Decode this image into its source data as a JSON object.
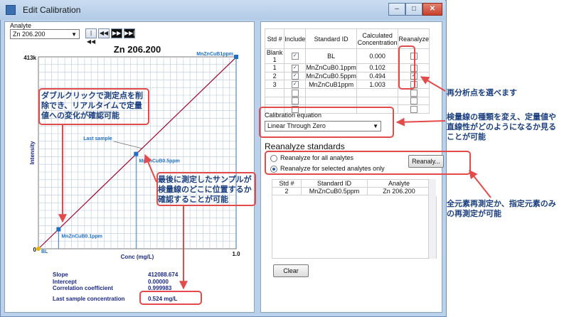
{
  "window": {
    "title": "Edit Calibration"
  },
  "analyte": {
    "label": "Analyte",
    "selected": "Zn 206.200"
  },
  "nav": [
    "|◀◀",
    "◀◀",
    "▶▶",
    "▶▶|"
  ],
  "chart_data": {
    "type": "scatter",
    "title": "Zn 206.200",
    "xlabel": "Conc (mg/L)",
    "ylabel": "Intensity",
    "xlim": [
      0,
      1.0
    ],
    "ylim": [
      0,
      413000
    ],
    "y_tick_labels": [
      "0",
      "413k"
    ],
    "x_tick_labels": [
      "0",
      "1.0"
    ],
    "grid": true,
    "points": [
      {
        "label": "BL",
        "x": 0.0,
        "y": 0
      },
      {
        "label": "MnZnCuB0.1ppm",
        "x": 0.102,
        "y": 42000
      },
      {
        "label": "MnZnCuB0.5ppm",
        "x": 0.494,
        "y": 204000
      },
      {
        "label": "MnZnCuB1ppm",
        "x": 1.003,
        "y": 413000
      }
    ],
    "last_sample": {
      "label": "Last sample",
      "x": 0.524,
      "y": 216000
    },
    "fit_line": {
      "x": [
        0,
        1.0
      ],
      "y": [
        0,
        412089
      ]
    }
  },
  "stats": {
    "slope_label": "Slope",
    "slope": "412088.674",
    "intercept_label": "Intercept",
    "intercept": "0.00000",
    "corr_label": "Correlation coefficient",
    "corr": "0.999983",
    "last_label": "Last sample concentration",
    "last": "0.524 mg/L"
  },
  "std_table": {
    "headers": [
      "Std #",
      "Include",
      "Standard ID",
      "Calculated Concentration",
      "Reanalyze"
    ],
    "rows": [
      {
        "std": "Blank 1",
        "include": true,
        "id": "BL",
        "conc": "0.000",
        "reanalyze": false
      },
      {
        "std": "1",
        "include": true,
        "id": "MnZnCuB0.1ppm",
        "conc": "0.102",
        "reanalyze": false
      },
      {
        "std": "2",
        "include": true,
        "id": "MnZnCuB0.5ppm",
        "conc": "0.494",
        "reanalyze": true
      },
      {
        "std": "3",
        "include": true,
        "id": "MnZnCuB1ppm",
        "conc": "1.003",
        "reanalyze": false
      }
    ]
  },
  "cal_eq": {
    "label": "Calibration equation",
    "selected": "Linear Through Zero"
  },
  "reanalyze": {
    "title": "Reanalyze standards",
    "opt_all": "Reanalyze for all analytes",
    "opt_selected": "Reanalyze for selected analytes only",
    "button": "Reanaly...",
    "headers": [
      "Std #",
      "Standard ID",
      "Analyte"
    ],
    "row": {
      "std": "2",
      "id": "MnZnCuB0.5ppm",
      "analyte": "Zn 206.200"
    },
    "clear": "Clear"
  },
  "annotations": {
    "a1": "ダブルクリックで測定点を削除でき、リアルタイムで定量値への変化が確認可能",
    "a2": "最後に測定したサンプルが検量線のどこに位置するか確認することが可能",
    "a3": "再分析点を選べます",
    "a4": "検量線の種類を変え、定量値や直線性がどのようになるか見ることが可能",
    "a5": "全元素再測定か、指定元素のみの再測定が可能"
  },
  "colors": {
    "annotation_red": "#e34a4a",
    "annotation_text": "#1b3f7f",
    "fit_line": "#a0002a",
    "point": "#1e6fc8"
  }
}
